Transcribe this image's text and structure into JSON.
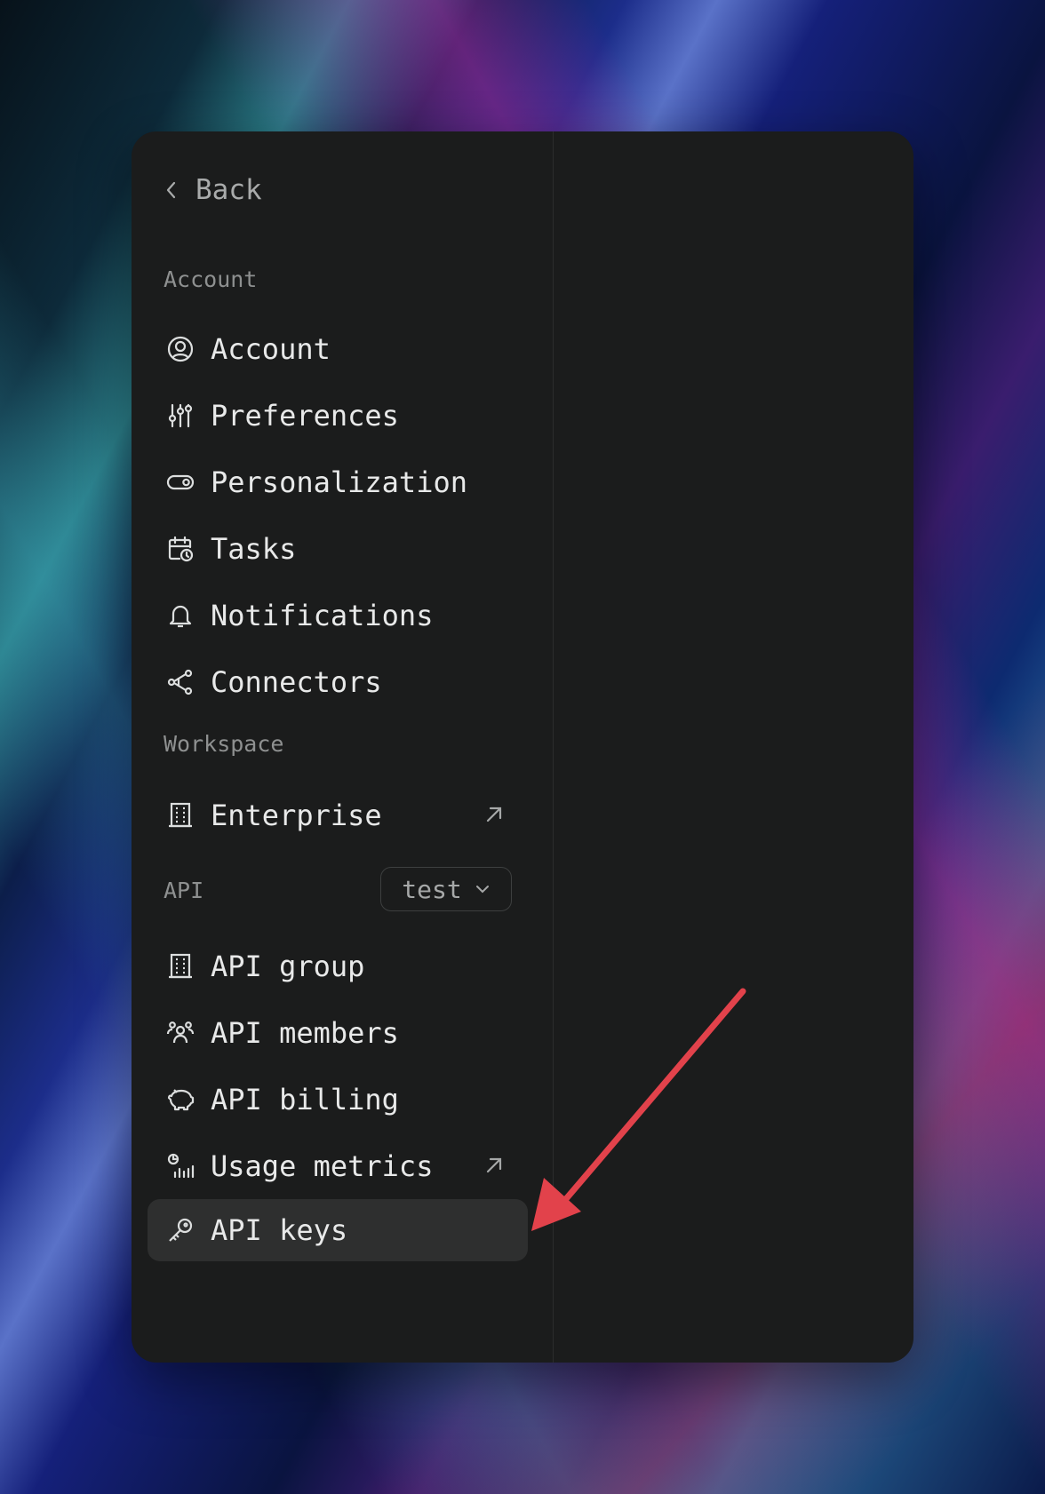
{
  "back": {
    "label": "Back",
    "icon": "chevron-left-icon"
  },
  "sections": {
    "account": "Account",
    "workspace": "Workspace",
    "api": "API"
  },
  "account_items": [
    {
      "label": "Account",
      "icon": "user-circle-icon"
    },
    {
      "label": "Preferences",
      "icon": "sliders-icon"
    },
    {
      "label": "Personalization",
      "icon": "toggle-icon"
    },
    {
      "label": "Tasks",
      "icon": "calendar-clock-icon"
    },
    {
      "label": "Notifications",
      "icon": "bell-icon"
    },
    {
      "label": "Connectors",
      "icon": "share-nodes-icon"
    }
  ],
  "workspace_items": [
    {
      "label": "Enterprise",
      "icon": "building-icon",
      "external": true
    }
  ],
  "api_selector": {
    "value": "test"
  },
  "api_items": [
    {
      "label": "API group",
      "icon": "building-icon"
    },
    {
      "label": "API members",
      "icon": "users-icon"
    },
    {
      "label": "API billing",
      "icon": "piggy-bank-icon"
    },
    {
      "label": "Usage metrics",
      "icon": "chart-bars-icon",
      "external": true
    },
    {
      "label": "API keys",
      "icon": "key-icon",
      "active": true
    }
  ],
  "colors": {
    "panel": "#1b1c1c",
    "active_item": "#2e2f2f",
    "annotation_arrow": "#e2424b"
  }
}
